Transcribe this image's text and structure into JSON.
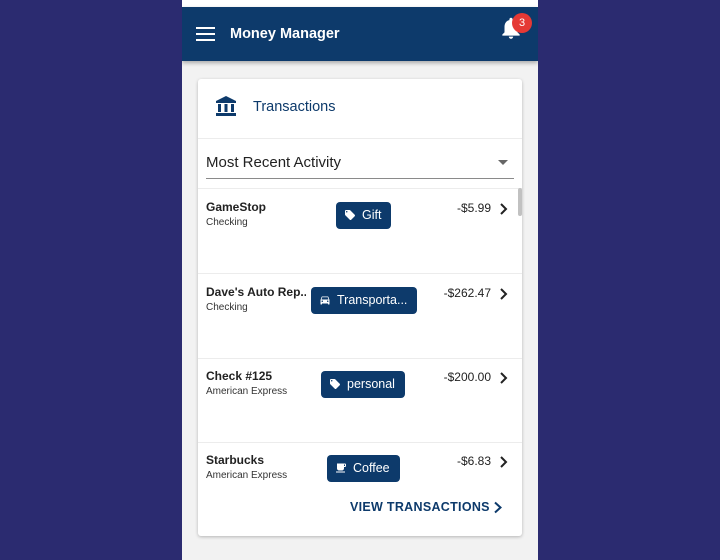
{
  "app": {
    "title": "Money Manager",
    "notification_count": "3"
  },
  "card": {
    "title": "Transactions",
    "filter": {
      "selected": "Most Recent Activity"
    },
    "view_all_label": "VIEW TRANSACTIONS"
  },
  "transactions": [
    {
      "merchant": "GameStop",
      "account": "Checking",
      "category": "Gift",
      "category_icon": "tag-icon",
      "amount": "-$5.99"
    },
    {
      "merchant": "Dave's Auto Rep...",
      "account": "Checking",
      "category": "Transporta...",
      "category_icon": "car-icon",
      "amount": "-$262.47"
    },
    {
      "merchant": "Check #125",
      "account": "American Express",
      "category": "personal",
      "category_icon": "tag-icon",
      "amount": "-$200.00"
    },
    {
      "merchant": "Starbucks",
      "account": "American Express",
      "category": "Coffee",
      "category_icon": "coffee-icon",
      "amount": "-$6.83"
    }
  ],
  "colors": {
    "background": "#2b2b70",
    "primary": "#0d3a6b",
    "badge": "#e53935"
  }
}
